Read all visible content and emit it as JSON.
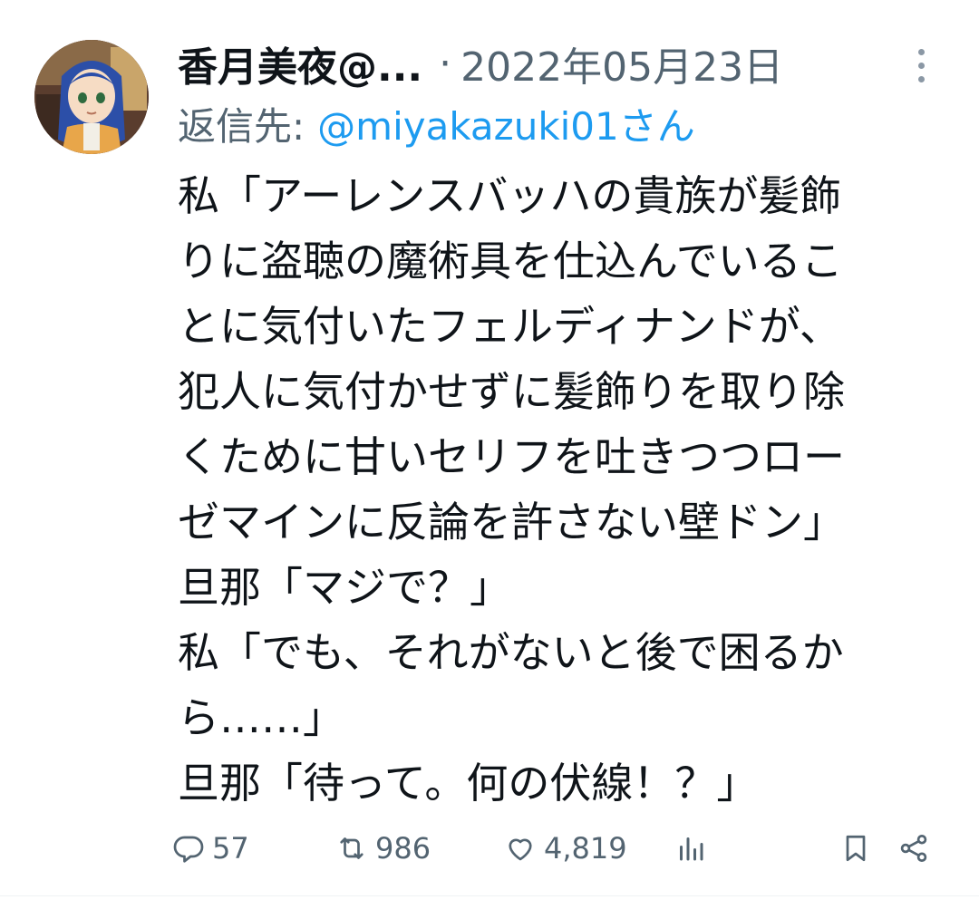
{
  "tweet": {
    "author": {
      "display_name": "香月美夜@...",
      "avatar_icon": "avatar-image"
    },
    "separator": "·",
    "date": "2022年05月23日",
    "reply": {
      "prefix": "返信先:",
      "handle": "@miyakazuki01さん"
    },
    "lines": [
      "私「アーレンスバッハの貴族が髪飾",
      "りに盗聴の魔術具を仕込んでいるこ",
      "とに気付いたフェルディナンドが、",
      "犯人に気付かせずに髪飾りを取り除",
      "くために甘いセリフを吐きつつロー",
      "ゼマインに反論を許さない壁ドン」",
      "旦那「マジで？」",
      "私「でも、それがないと後で困るか",
      "ら……」",
      "旦那「待って。何の伏線！？」"
    ],
    "actions": {
      "replies": "57",
      "retweets": "986",
      "likes": "4,819"
    }
  },
  "colors": {
    "text": "#0f1419",
    "secondary": "#536471",
    "link": "#1d9bf0",
    "divider": "#eff3f4"
  },
  "icons": [
    "more-vertical-icon",
    "reply-icon",
    "retweet-icon",
    "like-icon",
    "views-icon",
    "bookmark-icon",
    "share-icon"
  ]
}
